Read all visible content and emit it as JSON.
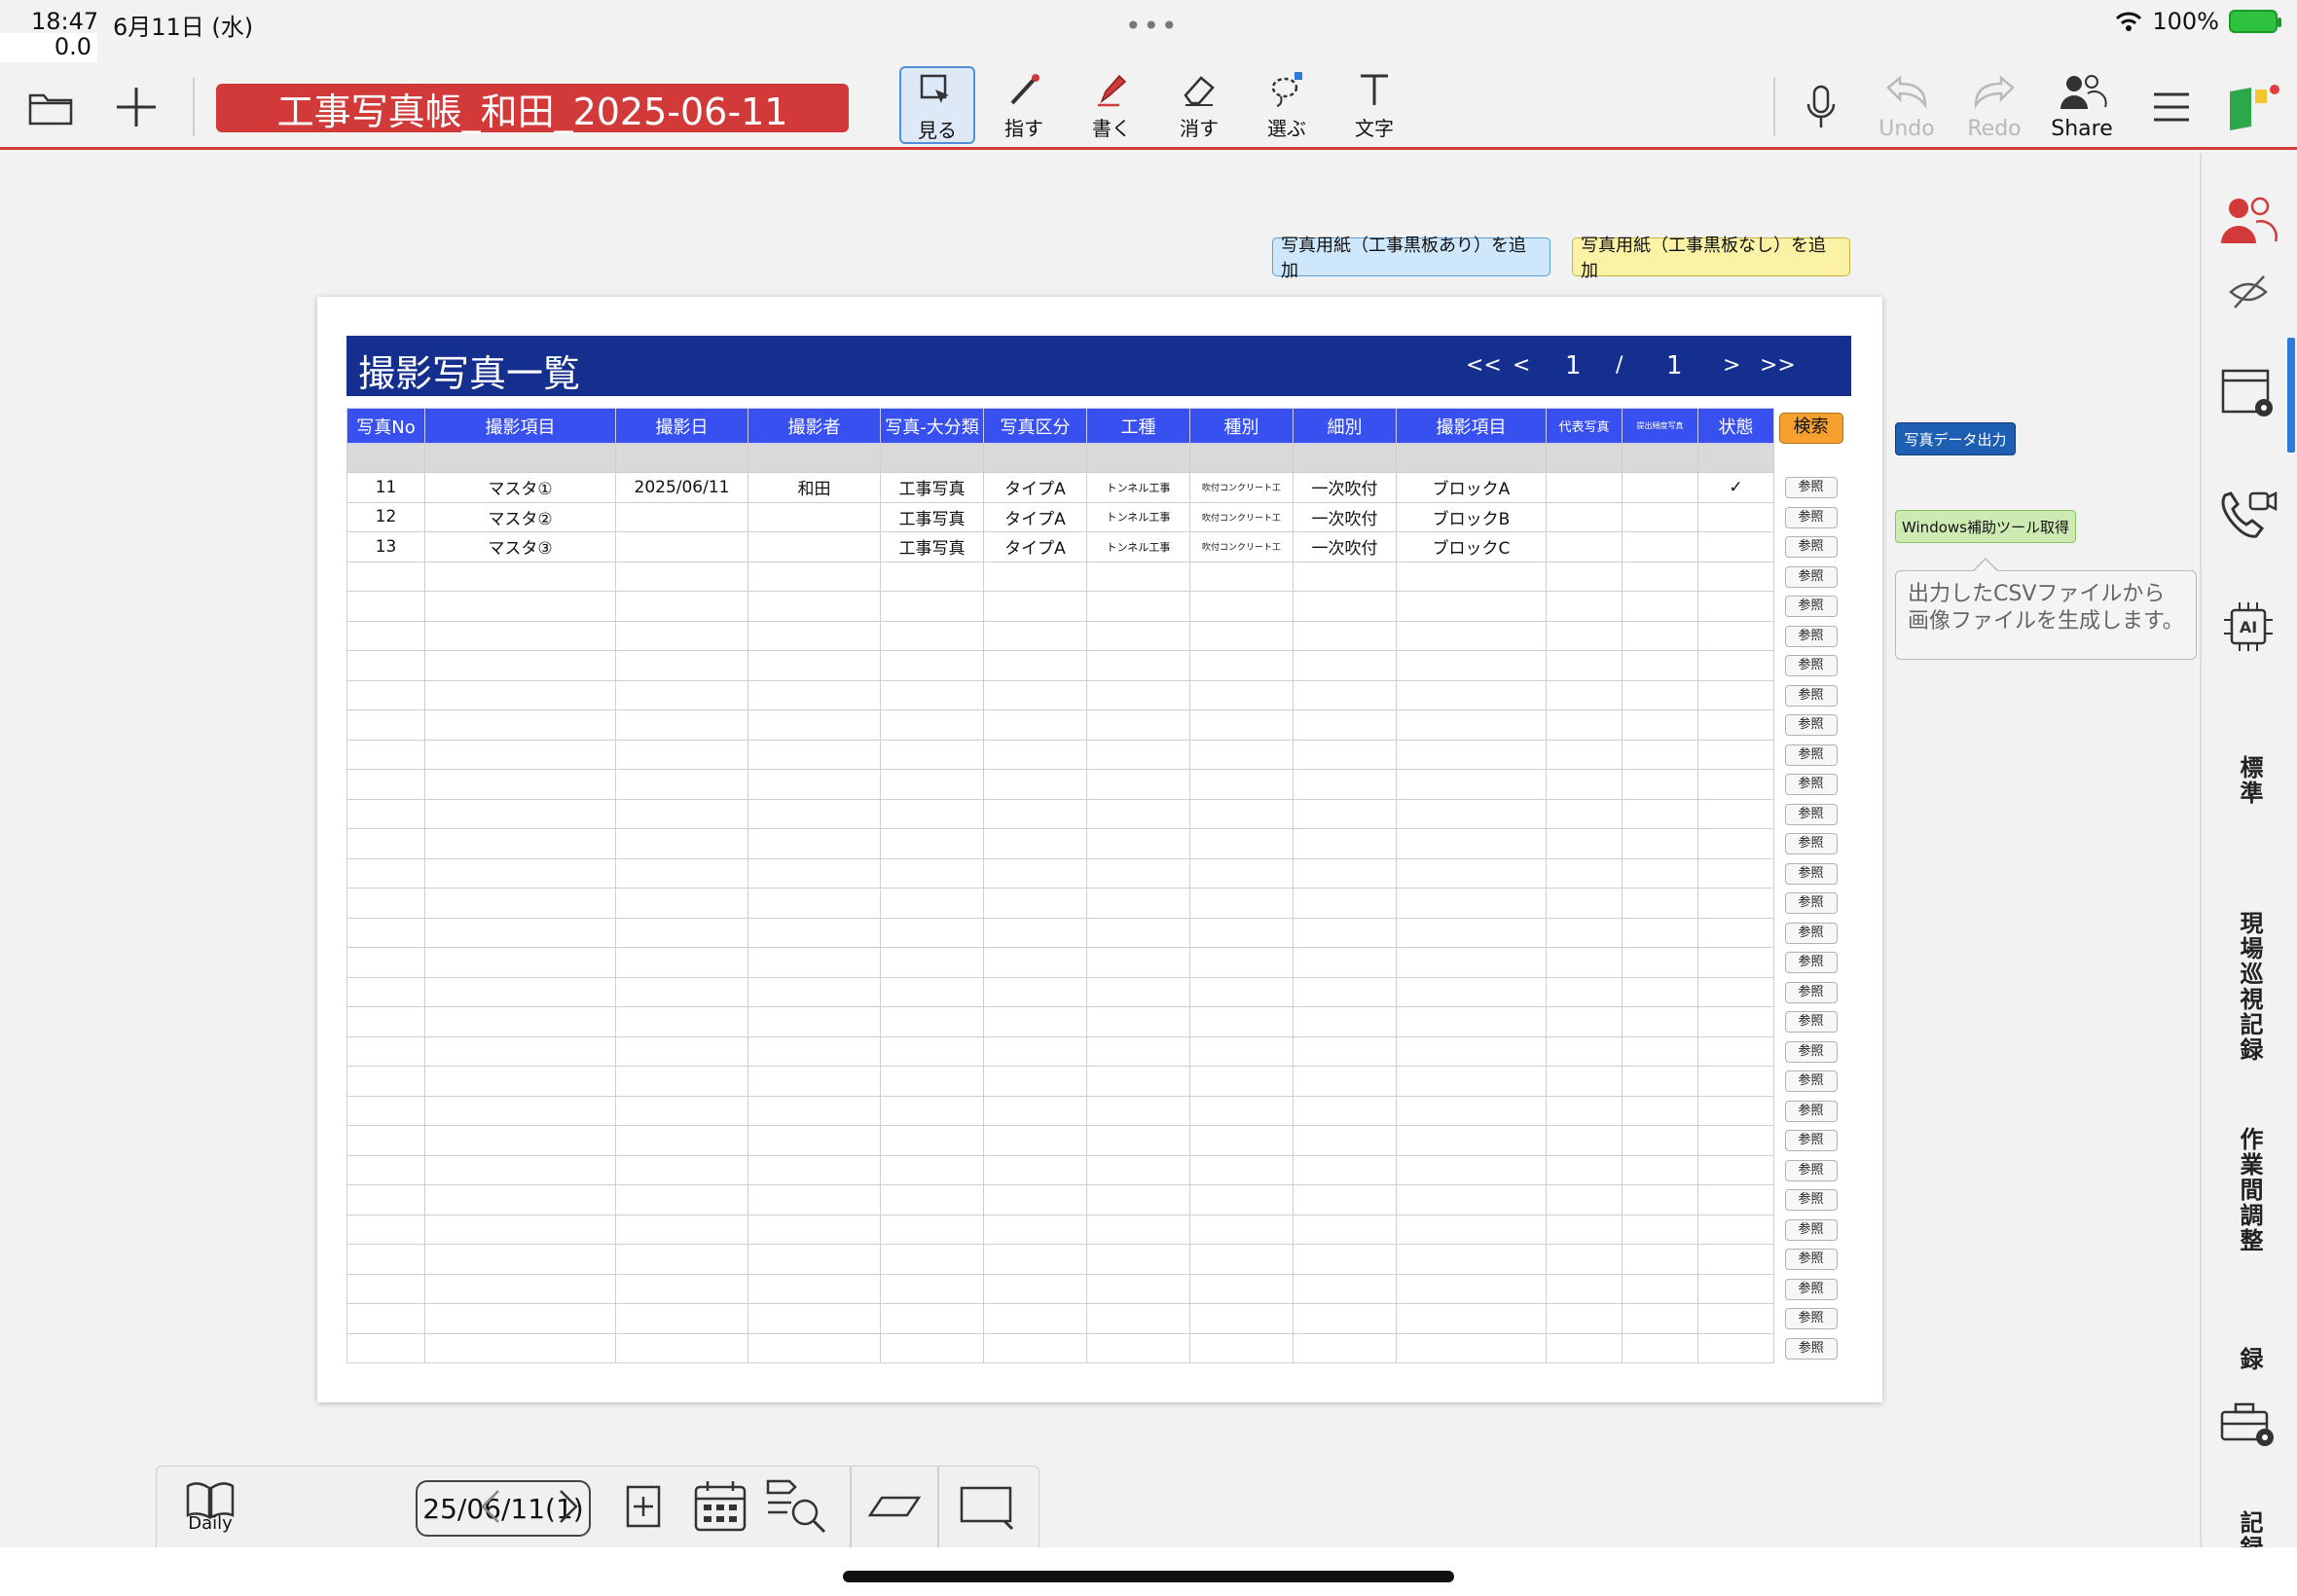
{
  "status": {
    "time": "18:47",
    "date": "6月11日 (水)",
    "zoom": "0.0",
    "battery": "100%"
  },
  "toolbar": {
    "doc_title": "工事写真帳_和田_2025-06-11",
    "tools": [
      {
        "label": "見る",
        "icon": "view-icon",
        "active": true
      },
      {
        "label": "指す",
        "icon": "laser-pointer-icon"
      },
      {
        "label": "書く",
        "icon": "pen-icon"
      },
      {
        "label": "消す",
        "icon": "eraser-icon"
      },
      {
        "label": "選ぶ",
        "icon": "lasso-icon"
      },
      {
        "label": "文字",
        "icon": "text-icon"
      }
    ],
    "undo": "Undo",
    "redo": "Redo",
    "share": "Share"
  },
  "actions": {
    "add_with_board": "写真用紙（工事黒板あり）を追加",
    "add_without_board": "写真用紙（工事黒板なし）を追加",
    "export": "写真データ出力",
    "windows_tool": "Windows補助ツール取得",
    "tooltip_line1": "出力したCSVファイルから",
    "tooltip_line2": "画像ファイルを生成します。"
  },
  "sheet": {
    "title": "撮影写真一覧",
    "pager": {
      "first": "<<",
      "prev": "<",
      "current": "1",
      "sep": "/",
      "total": "1",
      "next": ">",
      "last": ">>"
    },
    "columns": [
      "写真No",
      "撮影項目",
      "撮影日",
      "撮影者",
      "写真-大分類",
      "写真区分",
      "工種",
      "種別",
      "細別",
      "撮影項目",
      "代表写真",
      "提出頻度写真",
      "状態"
    ],
    "search_label": "検索",
    "ref_label": "参照",
    "rows": [
      [
        "11",
        "マスタ①",
        "2025/06/11",
        "和田",
        "工事写真",
        "タイプA",
        "トンネル工事",
        "吹付コンクリート工",
        "一次吹付",
        "ブロックA",
        "",
        "",
        "✓"
      ],
      [
        "12",
        "マスタ②",
        "",
        "",
        "工事写真",
        "タイプA",
        "トンネル工事",
        "吹付コンクリート工",
        "一次吹付",
        "ブロックB",
        "",
        "",
        ""
      ],
      [
        "13",
        "マスタ③",
        "",
        "",
        "工事写真",
        "タイプA",
        "トンネル工事",
        "吹付コンクリート工",
        "一次吹付",
        "ブロックC",
        "",
        "",
        ""
      ]
    ],
    "total_rows": 30
  },
  "side_panel": {
    "labels": [
      "標準",
      "現場巡視記録",
      "作業間調整",
      "録",
      "記録"
    ]
  },
  "bottom": {
    "daily": "Daily",
    "date": "25/06/11(1)"
  }
}
